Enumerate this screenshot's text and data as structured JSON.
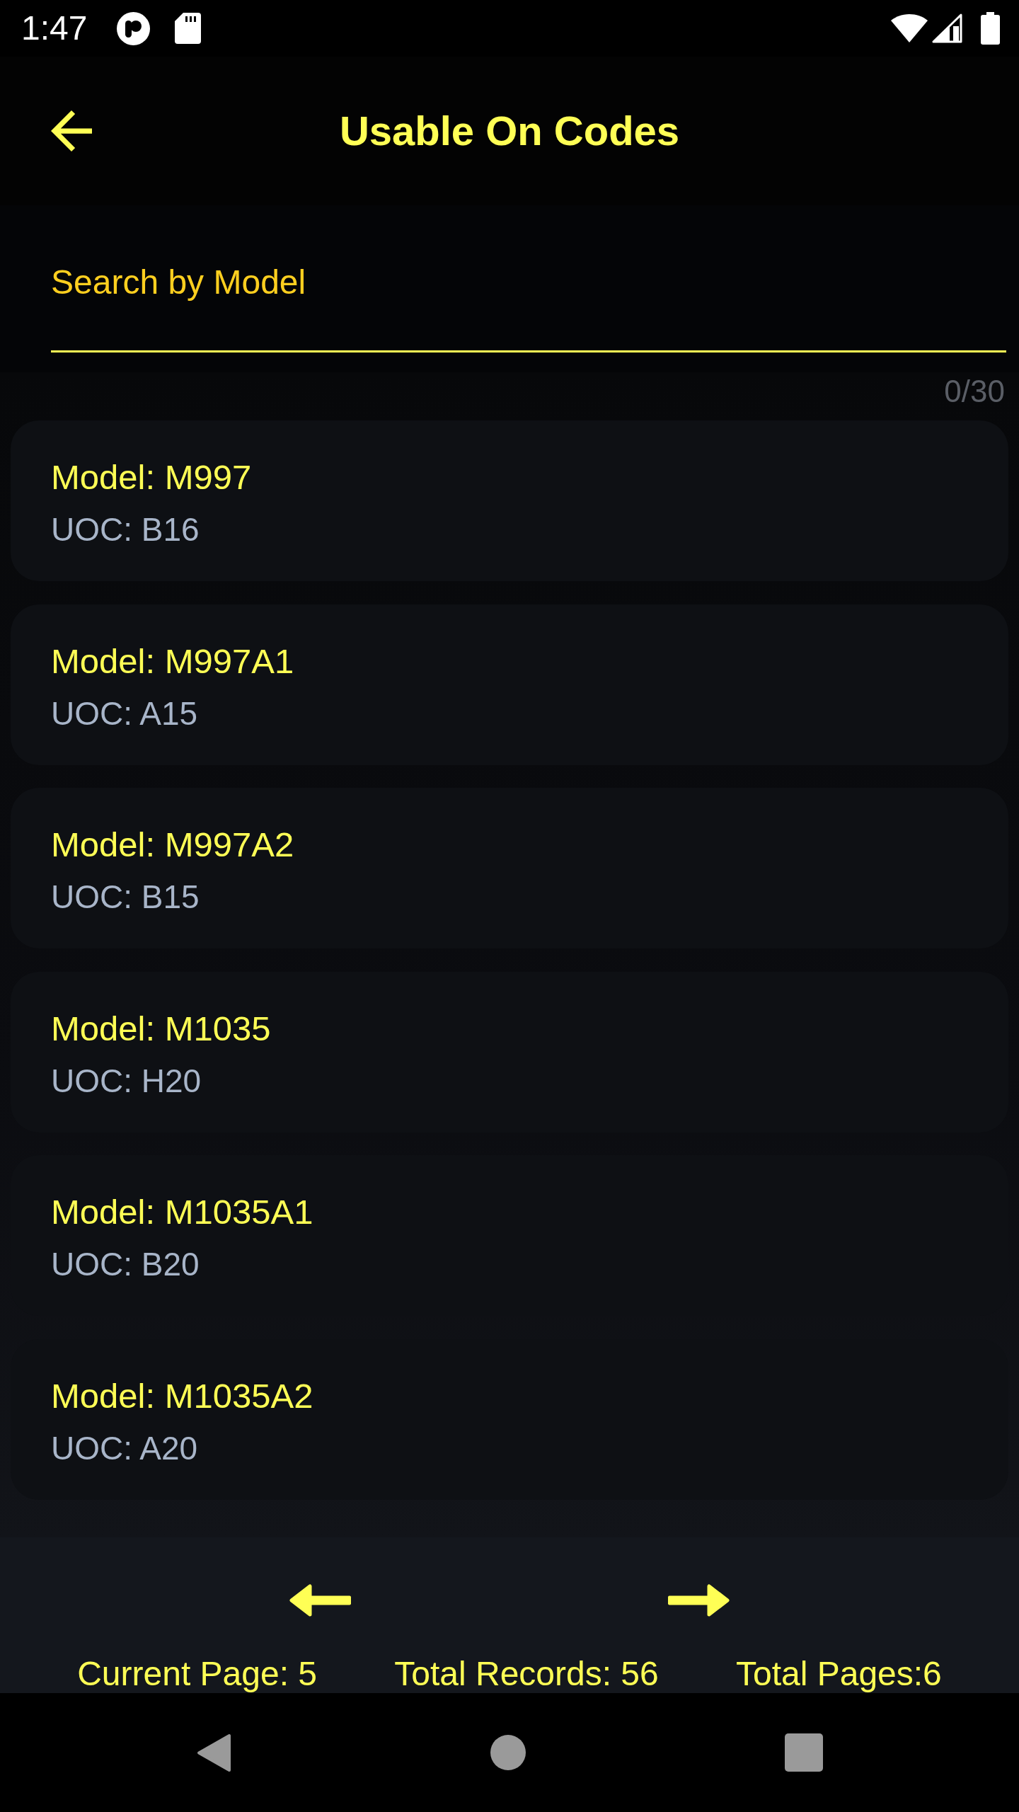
{
  "status_bar": {
    "time": "1:47"
  },
  "app_bar": {
    "title": "Usable On Codes"
  },
  "search": {
    "placeholder": "Search by Model",
    "counter": "0/30"
  },
  "records": [
    {
      "model": "Model: M997",
      "uoc": "UOC: B16"
    },
    {
      "model": "Model: M997A1",
      "uoc": "UOC: A15"
    },
    {
      "model": "Model: M997A2",
      "uoc": "UOC: B15"
    },
    {
      "model": "Model: M1035",
      "uoc": "UOC: H20"
    },
    {
      "model": "Model: M1035A1",
      "uoc": "UOC: B20"
    },
    {
      "model": "Model: M1035A2",
      "uoc": "UOC: A20"
    }
  ],
  "pagination": {
    "current_page": "Current Page: 5",
    "total_records": "Total Records: 56",
    "total_pages": "Total Pages:6"
  }
}
